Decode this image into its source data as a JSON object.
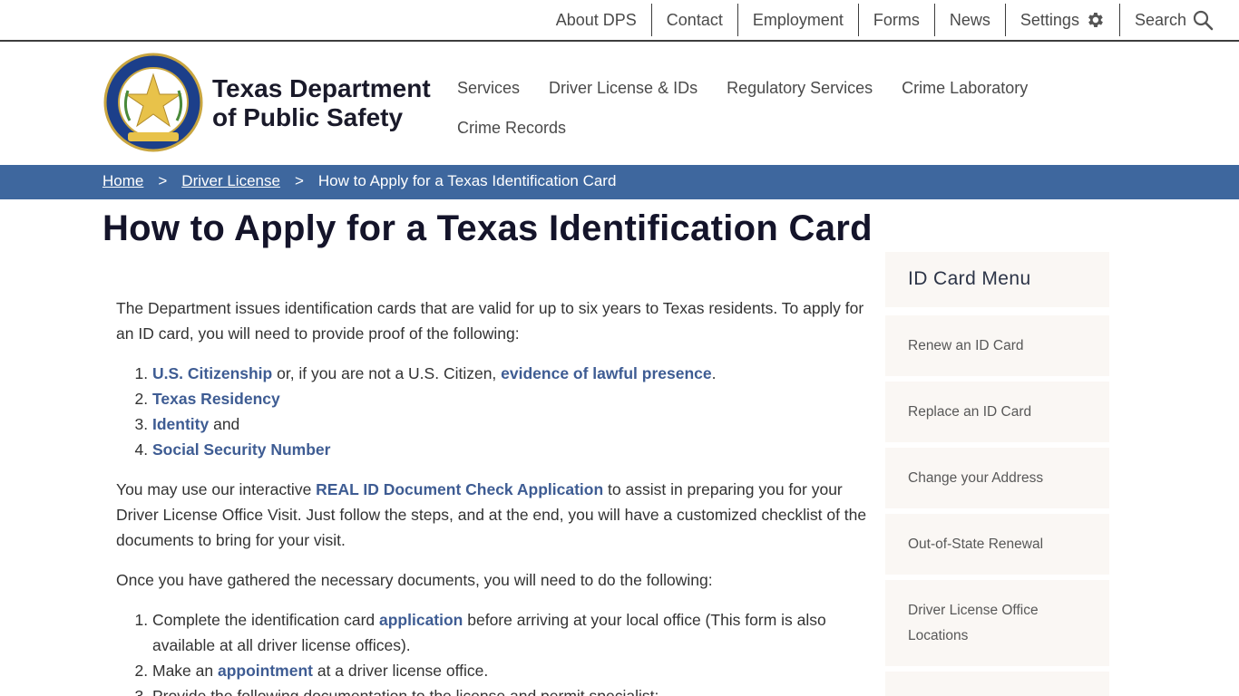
{
  "utility_nav": {
    "items": [
      "About DPS",
      "Contact",
      "Employment",
      "Forms",
      "News",
      "Settings",
      "Search"
    ]
  },
  "header": {
    "agency_line1": "Texas Department",
    "agency_line2": "of Public Safety",
    "seal_text": "DEPARTMENT OF PUBLIC SAFETY · TEXAS",
    "main_nav": [
      "Services",
      "Driver License & IDs",
      "Regulatory Services",
      "Crime Laboratory",
      "Crime Records"
    ]
  },
  "breadcrumb": {
    "home": "Home",
    "section": "Driver License",
    "current": "How to Apply for a Texas Identification Card",
    "separator": ">"
  },
  "page": {
    "title": "How to Apply for a Texas Identification Card"
  },
  "content": {
    "intro": "The Department issues identification cards that are valid for up to six years to Texas residents. To apply for an ID card, you will need to provide proof of the following:",
    "proof_list": [
      {
        "link": "U.S. Citizenship",
        "mid": " or, if you are not a U.S. Citizen, ",
        "link2": "evidence of lawful presence",
        "tail": "."
      },
      {
        "link": "Texas Residency",
        "tail": ""
      },
      {
        "link": "Identity",
        "tail": " and"
      },
      {
        "link": "Social Security Number",
        "tail": ""
      }
    ],
    "realid_pre": "You may use our interactive ",
    "realid_link": "REAL ID Document Check Application",
    "realid_post": " to assist in preparing you for your Driver License Office Visit. Just follow the steps, and at the end, you will have a customized checklist of the documents to bring for your visit.",
    "gathered": "Once you have gathered the necessary documents, you will need to do the following:",
    "steps": [
      {
        "pre": "Complete the identification card ",
        "link": "application",
        "post": " before arriving at your local office (This form is also available at all driver license offices)."
      },
      {
        "pre": "Make an ",
        "link": "appointment",
        "post": " at a driver license office."
      },
      {
        "pre": "Provide the following documentation to the license and permit specialist:",
        "link": "",
        "post": ""
      }
    ]
  },
  "sidebar": {
    "heading": "ID Card Menu",
    "items": [
      "Renew an ID Card",
      "Replace an ID Card",
      "Change your Address",
      "Out-of-State Renewal",
      "Driver License Office Locations"
    ]
  },
  "colors": {
    "breadcrumb_bar": "#3e679e",
    "link": "#3e5c93",
    "sidebar_bg": "#faf7f4",
    "seal_blue": "#1c3f8a",
    "seal_gold": "#e8c24a"
  }
}
